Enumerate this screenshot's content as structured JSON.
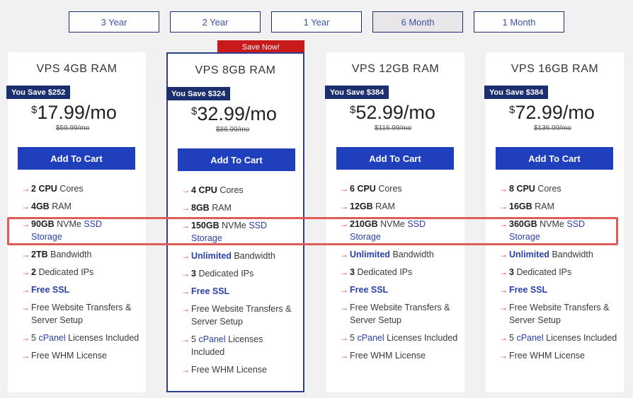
{
  "tabs": [
    "3 Year",
    "2 Year",
    "1 Year",
    "6 Month",
    "1 Month"
  ],
  "active_tab": "6 Month",
  "save_now": "Save Now!",
  "plans": [
    {
      "title": "VPS 4GB RAM",
      "badge": "You Save $252",
      "currency": "$",
      "price": "17.99",
      "per": "/mo",
      "old_price": "$59.99/mo",
      "button": "Add To Cart",
      "cpu": "2",
      "cpu_label": "CPU",
      "cpu_suffix": "Cores",
      "ram": "4GB",
      "ram_suffix": "RAM",
      "storage": "90GB",
      "storage_nvme": "NVMe",
      "storage_ssd": "SSD",
      "storage_word": "Storage",
      "bandwidth": "2TB",
      "bandwidth_suffix": "Bandwidth",
      "ips": "2",
      "ips_suffix": "Dedicated IPs",
      "ssl": "Free SSL",
      "transfer": "Free Website Transfers & Server Setup",
      "cpanel_pre": "5",
      "cpanel": "cPanel",
      "cpanel_post": "Licenses Included",
      "whm": "Free WHM License"
    },
    {
      "title": "VPS 8GB RAM",
      "badge": "You Save $324",
      "currency": "$",
      "price": "32.99",
      "per": "/mo",
      "old_price": "$86.99/mo",
      "button": "Add To Cart",
      "cpu": "4",
      "cpu_label": "CPU",
      "cpu_suffix": "Cores",
      "ram": "8GB",
      "ram_suffix": "RAM",
      "storage": "150GB",
      "storage_nvme": "NVMe",
      "storage_ssd": "SSD",
      "storage_word": "Storage",
      "bandwidth": "Unlimited",
      "bandwidth_suffix": "Bandwidth",
      "ips": "3",
      "ips_suffix": "Dedicated IPs",
      "ssl": "Free SSL",
      "transfer": "Free Website Transfers & Server Setup",
      "cpanel_pre": "5",
      "cpanel": "cPanel",
      "cpanel_post": "Licenses Included",
      "whm": "Free WHM License"
    },
    {
      "title": "VPS 12GB RAM",
      "badge": "You Save $384",
      "currency": "$",
      "price": "52.99",
      "per": "/mo",
      "old_price": "$116.99/mo",
      "button": "Add To Cart",
      "cpu": "6",
      "cpu_label": "CPU",
      "cpu_suffix": "Cores",
      "ram": "12GB",
      "ram_suffix": "RAM",
      "storage": "210GB",
      "storage_nvme": "NVMe",
      "storage_ssd": "SSD",
      "storage_word": "Storage",
      "bandwidth": "Unlimited",
      "bandwidth_suffix": "Bandwidth",
      "ips": "3",
      "ips_suffix": "Dedicated IPs",
      "ssl": "Free SSL",
      "transfer": "Free Website Transfers & Server Setup",
      "cpanel_pre": "5",
      "cpanel": "cPanel",
      "cpanel_post": "Licenses Included",
      "whm": "Free WHM License"
    },
    {
      "title": "VPS 16GB RAM",
      "badge": "You Save $384",
      "currency": "$",
      "price": "72.99",
      "per": "/mo",
      "old_price": "$136.99/mo",
      "button": "Add To Cart",
      "cpu": "8",
      "cpu_label": "CPU",
      "cpu_suffix": "Cores",
      "ram": "16GB",
      "ram_suffix": "RAM",
      "storage": "360GB",
      "storage_nvme": "NVMe",
      "storage_ssd": "SSD",
      "storage_word": "Storage",
      "bandwidth": "Unlimited",
      "bandwidth_suffix": "Bandwidth",
      "ips": "3",
      "ips_suffix": "Dedicated IPs",
      "ssl": "Free SSL",
      "transfer": "Free Website Transfers & Server Setup",
      "cpanel_pre": "5",
      "cpanel": "cPanel",
      "cpanel_post": "Licenses Included",
      "whm": "Free WHM License"
    }
  ],
  "colors": {
    "accent_blue": "#1f3fbd",
    "navy": "#1b2e6e",
    "link_blue": "#2a3fa8",
    "save_red": "#c8191b",
    "highlight_red": "#e05a5a"
  },
  "icons": {
    "feature_bullet": "arrow-right-icon"
  }
}
